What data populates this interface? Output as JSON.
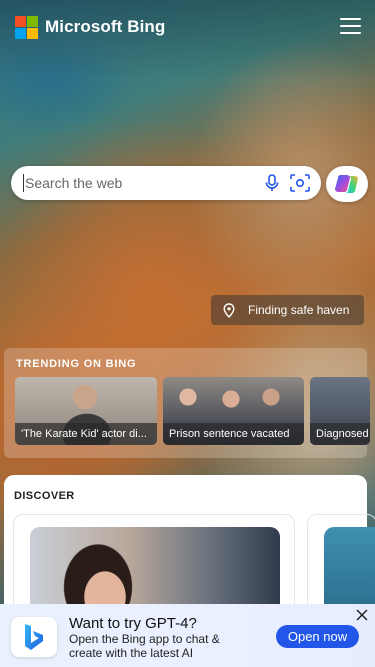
{
  "header": {
    "brand": "Microsoft Bing",
    "logo_colors": [
      "#f25022",
      "#7fba00",
      "#00a4ef",
      "#ffb900"
    ],
    "menu_icon": "hamburger-menu-icon"
  },
  "search": {
    "placeholder": "Search the web",
    "icons": [
      "microphone-icon",
      "visual-search-icon"
    ]
  },
  "copilot": {
    "icon": "copilot-icon"
  },
  "location": {
    "icon": "location-pin-icon",
    "label": "Finding safe haven"
  },
  "trending": {
    "title": "TRENDING ON BING",
    "items": [
      {
        "caption": "'The Karate Kid' actor di..."
      },
      {
        "caption": "Prison sentence vacated"
      },
      {
        "caption": "Diagnosed"
      }
    ]
  },
  "discover": {
    "title": "DISCOVER"
  },
  "promo": {
    "title": "Want to try GPT-4?",
    "subtitle": "Open the Bing app to chat & create with the latest AI",
    "button": "Open now",
    "accent": "#2156e8"
  }
}
